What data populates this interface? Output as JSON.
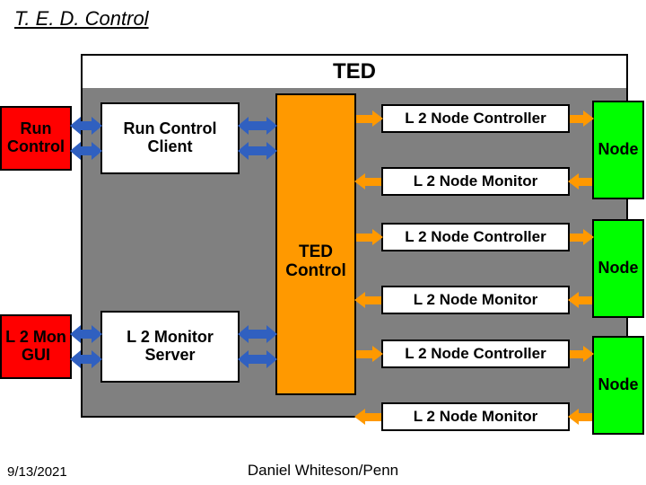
{
  "title": "T. E. D. Control",
  "ted_bar": "TED",
  "boxes": {
    "run_control": "Run Control",
    "run_control_client": "Run Control Client",
    "ted_control": "TED Control",
    "l2_mon_gui": "L 2 Mon GUI",
    "l2_monitor_server": "L 2 Monitor Server",
    "node": "Node"
  },
  "labels": {
    "l2_node_controller": "L 2 Node Controller",
    "l2_node_monitor": "L 2 Node Monitor"
  },
  "footer": {
    "date": "9/13/2021",
    "author": "Daniel Whiteson/Penn"
  },
  "colors": {
    "blue_arrow": "#3060c0",
    "orange_arrow": "#ff9900"
  },
  "chart_data": {
    "type": "diagram",
    "title": "T. E. D. Control",
    "nodes": [
      {
        "id": "run_control",
        "label": "Run Control",
        "color": "red"
      },
      {
        "id": "run_control_client",
        "label": "Run Control Client",
        "color": "white"
      },
      {
        "id": "ted_control",
        "label": "TED Control",
        "color": "orange"
      },
      {
        "id": "l2_mon_gui",
        "label": "L 2 Mon GUI",
        "color": "red"
      },
      {
        "id": "l2_monitor_server",
        "label": "L 2 Monitor Server",
        "color": "white"
      },
      {
        "id": "l2_node_controller_1",
        "label": "L 2 Node Controller",
        "color": "white"
      },
      {
        "id": "l2_node_monitor_1",
        "label": "L 2 Node Monitor",
        "color": "white"
      },
      {
        "id": "node_1",
        "label": "Node",
        "color": "green"
      },
      {
        "id": "l2_node_controller_2",
        "label": "L 2 Node Controller",
        "color": "white"
      },
      {
        "id": "l2_node_monitor_2",
        "label": "L 2 Node Monitor",
        "color": "white"
      },
      {
        "id": "node_2",
        "label": "Node",
        "color": "green"
      },
      {
        "id": "l2_node_controller_3",
        "label": "L 2 Node Controller",
        "color": "white"
      },
      {
        "id": "l2_node_monitor_3",
        "label": "L 2 Node Monitor",
        "color": "white"
      },
      {
        "id": "node_3",
        "label": "Node",
        "color": "green"
      }
    ],
    "edges": [
      {
        "from": "run_control",
        "to": "run_control_client",
        "dir": "both",
        "color": "blue"
      },
      {
        "from": "run_control_client",
        "to": "ted_control",
        "dir": "both",
        "color": "blue"
      },
      {
        "from": "l2_mon_gui",
        "to": "l2_monitor_server",
        "dir": "both",
        "color": "blue"
      },
      {
        "from": "l2_monitor_server",
        "to": "ted_control",
        "dir": "both",
        "color": "blue"
      },
      {
        "from": "ted_control",
        "to": "l2_node_controller_1",
        "dir": "to",
        "color": "orange"
      },
      {
        "from": "l2_node_monitor_1",
        "to": "ted_control",
        "dir": "to",
        "color": "orange"
      },
      {
        "from": "ted_control",
        "to": "l2_node_controller_2",
        "dir": "to",
        "color": "orange"
      },
      {
        "from": "l2_node_monitor_2",
        "to": "ted_control",
        "dir": "to",
        "color": "orange"
      },
      {
        "from": "ted_control",
        "to": "l2_node_controller_3",
        "dir": "to",
        "color": "orange"
      },
      {
        "from": "l2_node_monitor_3",
        "to": "ted_control",
        "dir": "to",
        "color": "orange"
      },
      {
        "from": "l2_node_controller_1",
        "to": "node_1",
        "dir": "to",
        "color": "orange"
      },
      {
        "from": "node_1",
        "to": "l2_node_monitor_1",
        "dir": "to",
        "color": "orange"
      },
      {
        "from": "l2_node_controller_2",
        "to": "node_2",
        "dir": "to",
        "color": "orange"
      },
      {
        "from": "node_2",
        "to": "l2_node_monitor_2",
        "dir": "to",
        "color": "orange"
      },
      {
        "from": "l2_node_controller_3",
        "to": "node_3",
        "dir": "to",
        "color": "orange"
      },
      {
        "from": "node_3",
        "to": "l2_node_monitor_3",
        "dir": "to",
        "color": "orange"
      }
    ]
  }
}
